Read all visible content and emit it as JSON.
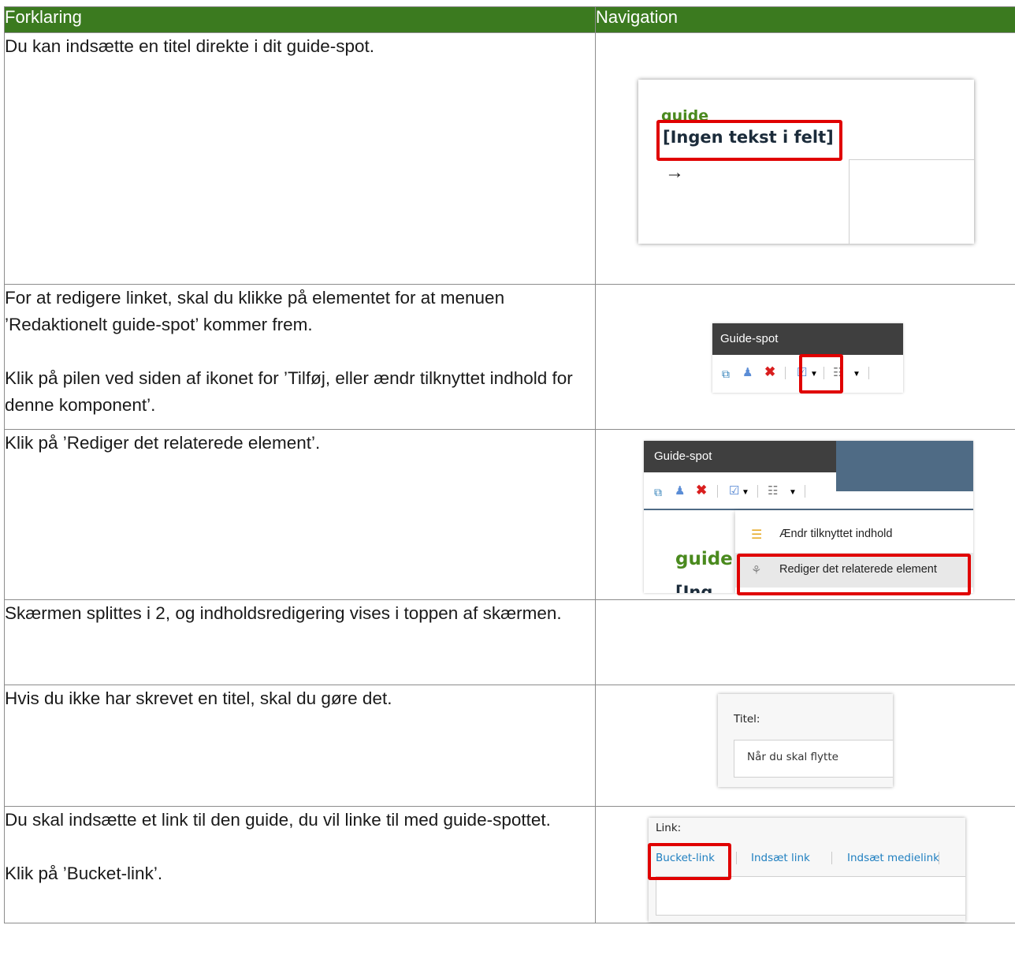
{
  "header": {
    "col1": "Forklaring",
    "col2": "Navigation"
  },
  "rows": [
    {
      "p1": "Du kan indsætte en titel direkte i dit guide-spot."
    },
    {
      "p1": "For at redigere linket, skal du klikke på elementet for at menuen ’Redaktionelt guide-spot’ kommer frem.",
      "p2": "Klik på pilen ved siden af ikonet for ’Tilføj, eller ændr tilknyttet indhold for denne komponent’."
    },
    {
      "p1": "Klik på ’Rediger det relaterede element’."
    },
    {
      "p1": "Skærmen splittes i 2, og indholdsredigering vises i toppen af skærmen."
    },
    {
      "p1": "Hvis du ikke har skrevet en titel, skal du gøre det."
    },
    {
      "p1": "Du skal indsætte et link til den guide, du vil linke til med guide-spottet.",
      "p2": "Klik på ’Bucket-link’."
    }
  ],
  "shot1": {
    "label": "guide",
    "placeholder": "[Ingen tekst i felt]",
    "arrow": "→"
  },
  "shot2": {
    "title": "Guide-spot"
  },
  "shot3": {
    "title": "Guide-spot",
    "label_guide": "guide",
    "label_partial": "[Ing",
    "menu_item_1": "Ændr tilknyttet indhold",
    "menu_item_2": "Rediger det relaterede element"
  },
  "shot5": {
    "field_label": "Titel:",
    "field_value": "Når du skal flytte"
  },
  "shot6": {
    "field_label": "Link:",
    "tabs": [
      "Bucket-link",
      "Indsæt link",
      "Indsæt medielink"
    ]
  },
  "colors": {
    "header_green": "#3b7a1f",
    "guide_green": "#4a8a1e",
    "highlight_red": "#e00000",
    "toolbar_dark": "#3f3f3f",
    "link_blue": "#1f7fc0"
  },
  "icons": [
    "insert-icon",
    "users-icon",
    "delete-icon",
    "edit-content-icon",
    "chevron-down-icon",
    "structure-icon",
    "file-icon",
    "related-icon"
  ]
}
